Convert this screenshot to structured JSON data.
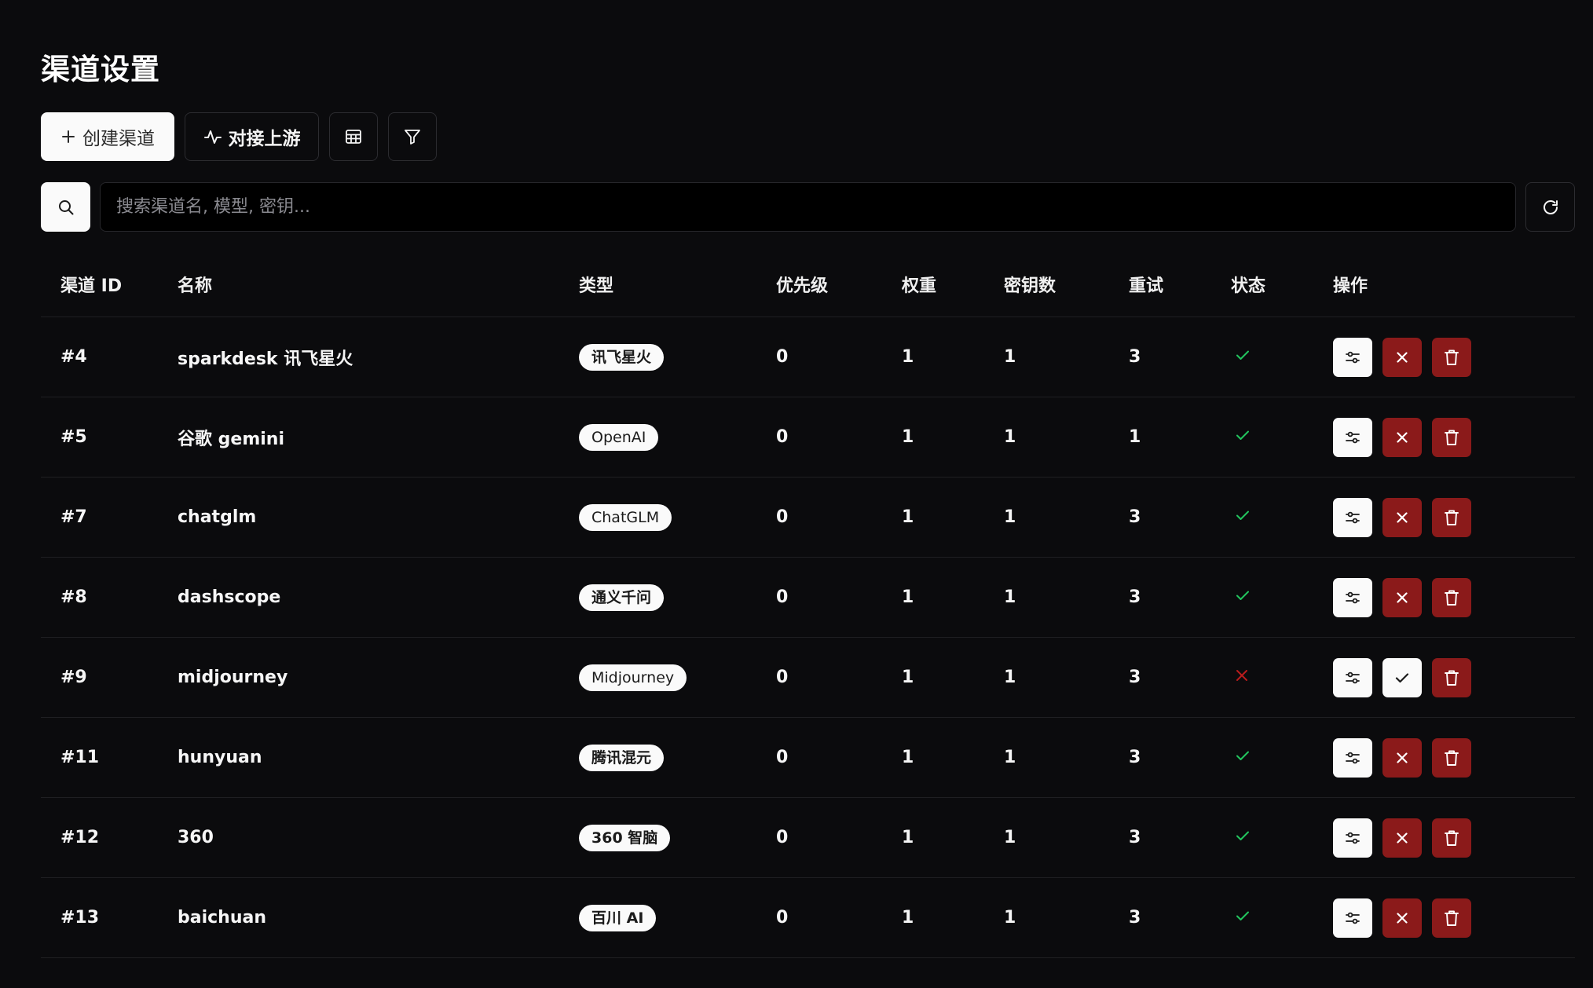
{
  "page": {
    "title": "渠道设置"
  },
  "toolbar": {
    "create_label": "创建渠道",
    "upstream_label": "对接上游",
    "table_icon": "table-icon",
    "filter_icon": "filter-icon"
  },
  "search": {
    "placeholder": "搜索渠道名, 模型, 密钥..."
  },
  "table": {
    "headers": [
      "渠道 ID",
      "名称",
      "类型",
      "优先级",
      "权重",
      "密钥数",
      "重试",
      "状态",
      "操作"
    ],
    "rows": [
      {
        "id": "#4",
        "name": "sparkdesk 讯飞星火",
        "type": "讯飞星火",
        "priority": "0",
        "weight": "1",
        "keys": "1",
        "retry": "3",
        "enabled": true
      },
      {
        "id": "#5",
        "name": "谷歌 gemini",
        "type": "OpenAI",
        "priority": "0",
        "weight": "1",
        "keys": "1",
        "retry": "1",
        "enabled": true
      },
      {
        "id": "#7",
        "name": "chatglm",
        "type": "ChatGLM",
        "priority": "0",
        "weight": "1",
        "keys": "1",
        "retry": "3",
        "enabled": true
      },
      {
        "id": "#8",
        "name": "dashscope",
        "type": "通义千问",
        "priority": "0",
        "weight": "1",
        "keys": "1",
        "retry": "3",
        "enabled": true
      },
      {
        "id": "#9",
        "name": "midjourney",
        "type": "Midjourney",
        "priority": "0",
        "weight": "1",
        "keys": "1",
        "retry": "3",
        "enabled": false
      },
      {
        "id": "#11",
        "name": "hunyuan",
        "type": "腾讯混元",
        "priority": "0",
        "weight": "1",
        "keys": "1",
        "retry": "3",
        "enabled": true
      },
      {
        "id": "#12",
        "name": "360",
        "type": "360 智脑",
        "priority": "0",
        "weight": "1",
        "keys": "1",
        "retry": "3",
        "enabled": true
      },
      {
        "id": "#13",
        "name": "baichuan",
        "type": "百川 AI",
        "priority": "0",
        "weight": "1",
        "keys": "1",
        "retry": "3",
        "enabled": true
      }
    ]
  },
  "colors": {
    "background": "#0b0b0d",
    "enabled": "#22c55e",
    "disabled": "#b91c1c",
    "danger": "#8b1a1a"
  }
}
